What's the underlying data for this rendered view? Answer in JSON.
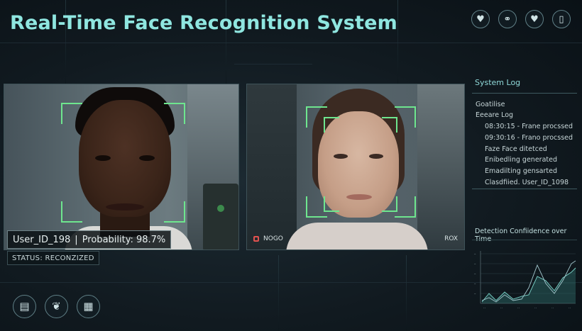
{
  "header": {
    "title": "Real-Time Face Recognition System"
  },
  "top_icons": [
    "heart-icon",
    "share-icon",
    "heart-icon",
    "mobile-icon"
  ],
  "camera1": {
    "identity_label": "User_ID_198",
    "separator": "|",
    "probability_label": "Probability: 98.7%",
    "status": "STATUS: RECONZIZED"
  },
  "camera2": {
    "rec_label": "NOGO",
    "corner_label": "ROX"
  },
  "system_log": {
    "title": "System Log",
    "lines": [
      "Goatilise",
      "Eeeare Log",
      "08:30:15 - Frane procssed",
      "09:30:16 - Frano procssed",
      "Faze  Face ditetced",
      "Enibedling generated",
      "Emadilting gensarted",
      "Clasdfiied. User_ID_1098"
    ]
  },
  "chart": {
    "title": "Detection Confiidence over Time"
  },
  "bottom_icons": [
    "bookmark-icon",
    "leaf-icon",
    "calculator-icon"
  ],
  "colors": {
    "accent": "#8fe6e0",
    "frame": "#6ee68e",
    "rec": "#e0524f"
  }
}
